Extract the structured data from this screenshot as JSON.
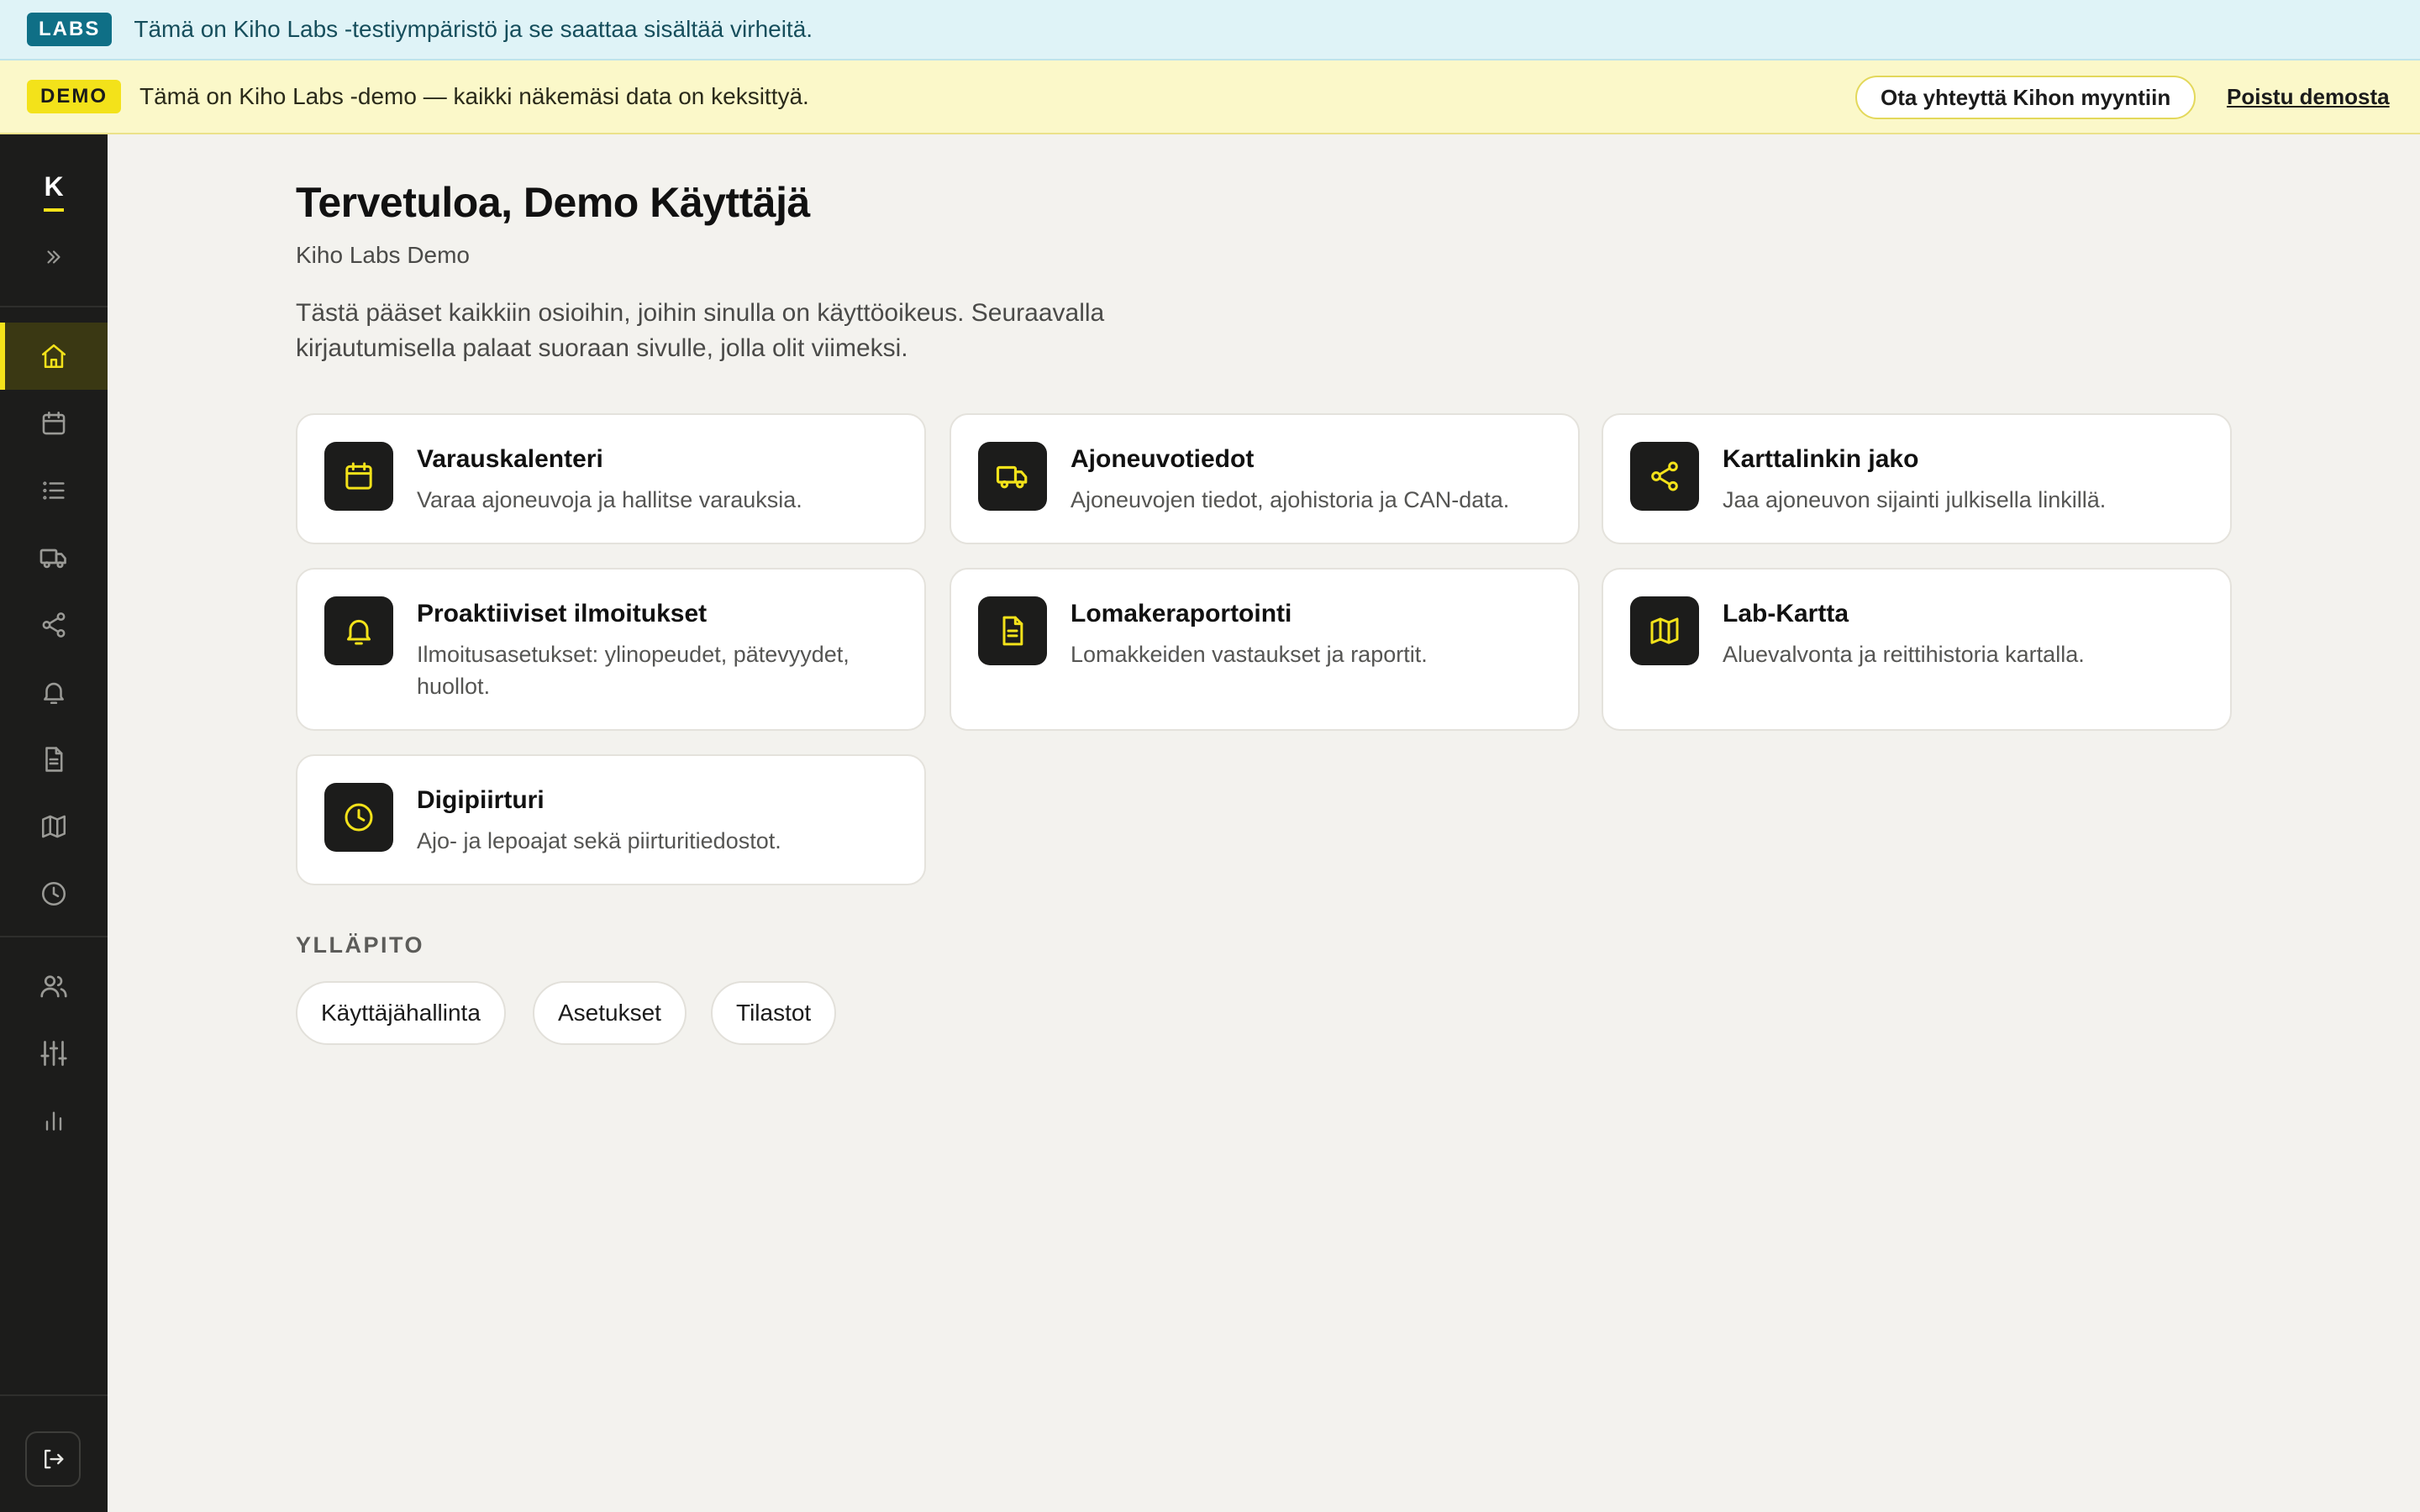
{
  "labs_banner": {
    "badge": "LABS",
    "text": "Tämä on Kiho Labs -testiympäristö ja se saattaa sisältää virheitä."
  },
  "demo_banner": {
    "badge": "DEMO",
    "text": "Tämä on Kiho Labs -demo — kaikki näkemäsi data on keksittyä.",
    "contact_button": "Ota yhteyttä Kihon myyntiin",
    "exit_link": "Poistu demosta"
  },
  "sidebar": {
    "logo": "K",
    "items": [
      {
        "icon": "home-icon",
        "active": true
      },
      {
        "icon": "calendar-icon",
        "active": false
      },
      {
        "icon": "list-icon",
        "active": false
      },
      {
        "icon": "truck-icon",
        "active": false
      },
      {
        "icon": "share-icon",
        "active": false
      },
      {
        "icon": "bell-icon",
        "active": false
      },
      {
        "icon": "document-icon",
        "active": false
      },
      {
        "icon": "map-icon",
        "active": false
      },
      {
        "icon": "clock-icon",
        "active": false
      }
    ],
    "admin_items": [
      {
        "icon": "users-icon"
      },
      {
        "icon": "sliders-icon"
      },
      {
        "icon": "bar-chart-icon"
      }
    ],
    "logout_icon": "logout-icon"
  },
  "main": {
    "title": "Tervetuloa, Demo Käyttäjä",
    "subtitle": "Kiho Labs Demo",
    "intro": "Tästä pääset kaikkiin osioihin, joihin sinulla on käyttöoikeus. Seuraavalla kirjautumisella palaat suoraan sivulle, jolla olit viimeksi.",
    "cards": [
      {
        "icon": "calendar-icon",
        "title": "Varauskalenteri",
        "desc": "Varaa ajoneuvoja ja hallitse varauksia."
      },
      {
        "icon": "truck-icon",
        "title": "Ajoneuvotiedot",
        "desc": "Ajoneuvojen tiedot, ajohistoria ja CAN-data."
      },
      {
        "icon": "share-icon",
        "title": "Karttalinkin jako",
        "desc": "Jaa ajoneuvon sijainti julkisella linkillä."
      },
      {
        "icon": "bell-icon",
        "title": "Proaktiiviset ilmoitukset",
        "desc": "Ilmoitusasetukset: ylinopeudet, pätevyydet, huollot."
      },
      {
        "icon": "document-icon",
        "title": "Lomakeraportointi",
        "desc": "Lomakkeiden vastaukset ja raportit."
      },
      {
        "icon": "map-icon",
        "title": "Lab-Kartta",
        "desc": "Aluevalvonta ja reittihistoria kartalla."
      },
      {
        "icon": "clock-icon",
        "title": "Digipiirturi",
        "desc": "Ajo- ja lepoajat sekä piirturitiedostot."
      }
    ],
    "admin_section_label": "YLLÄPITO",
    "admin_buttons": [
      "Käyttäjähallinta",
      "Asetukset",
      "Tilastot"
    ]
  },
  "colors": {
    "accent": "#f3e21a",
    "sidebar_bg": "#1c1c1b",
    "page_bg": "#f3f2ee",
    "labs_badge": "#0f6f86"
  }
}
